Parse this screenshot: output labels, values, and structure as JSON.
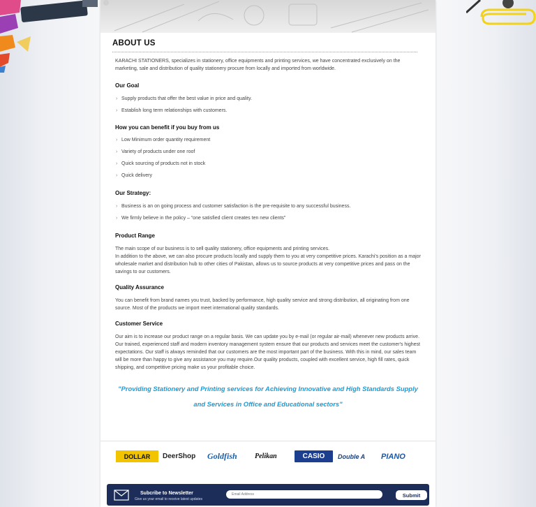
{
  "about": {
    "title": "ABOUT US",
    "intro": "KARACHI STATIONERS, specializes in stationery, office equipments and printing services, we have concentrated exclusively on the marketing, sale and distribution of quality stationery procure from locally and imported from worldwide."
  },
  "goal": {
    "heading": "Our Goal",
    "items": [
      "Supply products that offer the best value in price and quality.",
      "Establish long term relationships with customers."
    ]
  },
  "benefit": {
    "heading": "How you can benefit if you buy from us",
    "items": [
      "Low Minimum order quantity requirement",
      "Variety of products under one roof",
      "Quick sourcing of products not in stock",
      "Quick delivery"
    ]
  },
  "strategy": {
    "heading": "Our Strategy:",
    "items": [
      "Business is an on going process and customer satisfaction is the pre-requisite to any successful business.",
      "We firmly believe in the policy – “one satisfied client creates ten new clients”"
    ]
  },
  "product_range": {
    "heading": "Product Range",
    "p1": "The main scope of our business is to sell quality stationery, office equipments and printing services.",
    "p2": "In addition to the above, we can also procure products locally and supply them to you at very competitive prices. Karachi's position as a major wholesale market and distribution hub to other cities of Pakistan, allows us to source products at very competitive prices and pass on the savings to our customers."
  },
  "quality": {
    "heading": "Quality Assurance",
    "p1": "You can benefit from brand names you trust, backed by performance, high quality service and strong distribution, all originating from one source. Most of the products we import meet international quality standards."
  },
  "service": {
    "heading": "Customer Service",
    "p1": "Our aim is to increase our product range on a regular basis. We can update you by e-mail (or regular air-mail) whenever new products arrive. Our trained, experienced staff and modern inventory management system ensure that our products and services meet the customer's highest expectations. Our staff is always reminded that our customers are the most important part of the business. With this in mind, our sales team will be more than happy to give any assistance you may require.Our quality products, coupled with excellent service, high fill rates, quick shipping, and competitive pricing make us your profitable choice."
  },
  "quote": {
    "line1": "\"Providing Stationery and Printing services for Achieving Innovative and High Standards Supply",
    "line2": "and Services in Office and Educational sectors\""
  },
  "brands": [
    "DOLLAR",
    "DeerShop",
    "Goldfish",
    "Pelikan",
    "CASIO",
    "Double A",
    "PIANO"
  ],
  "newsletter": {
    "title": "Subcribe to Newsletter",
    "subtitle": "Give us your email to receive latest updates",
    "placeholder": "Email Address",
    "submit": "Submit"
  },
  "colors": {
    "accent": "#1e9ad6",
    "newsletter_bg": "#1b2d58"
  }
}
